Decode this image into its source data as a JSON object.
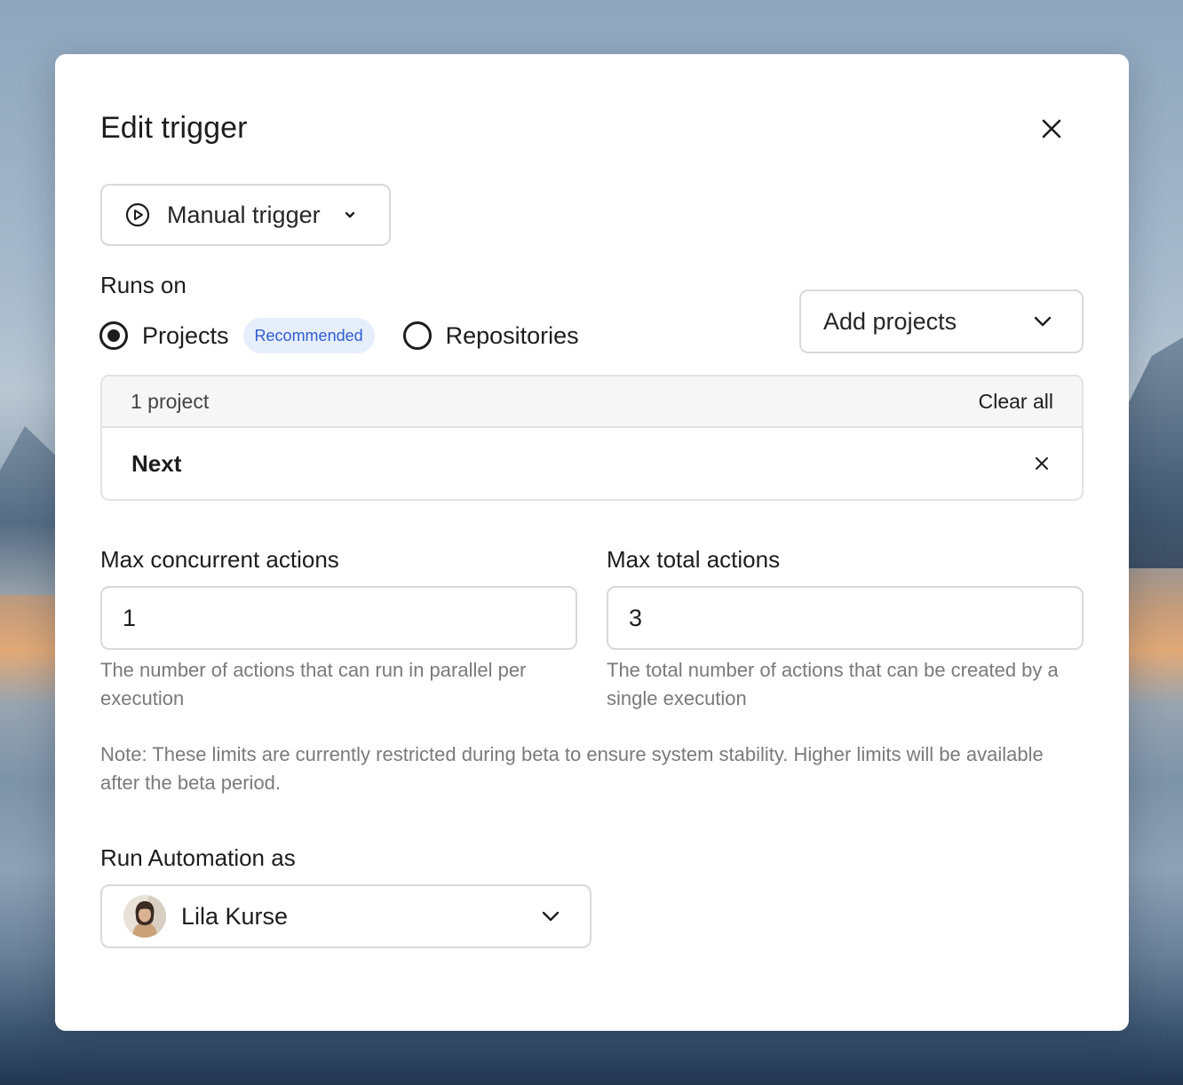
{
  "modal": {
    "title": "Edit trigger"
  },
  "trigger": {
    "selected": "Manual trigger",
    "icon": "play-circle-icon"
  },
  "runs_on": {
    "label": "Runs on",
    "options": [
      {
        "label": "Projects",
        "selected": true,
        "badge": "Recommended"
      },
      {
        "label": "Repositories",
        "selected": false
      }
    ],
    "add_select_label": "Add projects"
  },
  "projects": {
    "count_label": "1 project",
    "clear_label": "Clear all",
    "items": [
      "Next"
    ]
  },
  "limits": {
    "concurrent": {
      "label": "Max concurrent actions",
      "value": "1",
      "help": "The number of actions that can run in parallel per execution"
    },
    "total": {
      "label": "Max total actions",
      "value": "3",
      "help": "The total number of actions that can be created by a single execution"
    },
    "note": "Note: These limits are currently restricted during beta to ensure system stability. Higher limits will be available after the beta period."
  },
  "run_as": {
    "label": "Run Automation as",
    "user_name": "Lila Kurse"
  },
  "colors": {
    "badge_bg": "#e6eefb",
    "badge_text": "#2f5dd1",
    "text_primary": "#1d1d1f",
    "text_muted": "#7a7a7a",
    "border": "#d9d9d9"
  }
}
